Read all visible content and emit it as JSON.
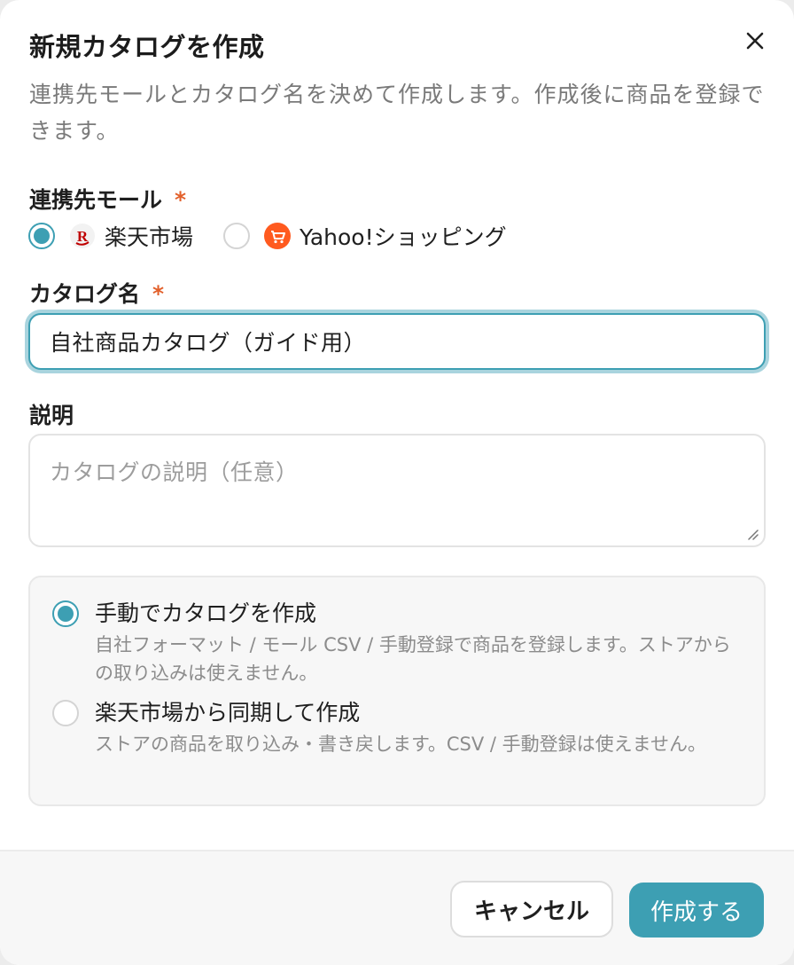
{
  "dialog": {
    "title": "新規カタログを作成",
    "subtitle": "連携先モールとカタログ名を決めて作成します。作成後に商品を登録できます。"
  },
  "mall": {
    "label": "連携先モール",
    "required_mark": "*",
    "options": [
      {
        "label": "楽天市場",
        "icon": "rakuten-logo-icon",
        "selected": true
      },
      {
        "label": "Yahoo!ショッピング",
        "icon": "yahoo-shopping-logo-icon",
        "selected": false
      }
    ]
  },
  "catalog_name": {
    "label": "カタログ名",
    "required_mark": "*",
    "value": "自社商品カタログ（ガイド用）"
  },
  "description": {
    "label": "説明",
    "placeholder": "カタログの説明（任意）",
    "value": ""
  },
  "creation_mode": {
    "options": [
      {
        "title": "手動でカタログを作成",
        "description": "自社フォーマット / モール CSV / 手動登録で商品を登録します。ストアからの取り込みは使えません。",
        "selected": true
      },
      {
        "title": "楽天市場から同期して作成",
        "description": "ストアの商品を取り込み・書き戻します。CSV / 手動登録は使えません。",
        "selected": false
      }
    ]
  },
  "footer": {
    "cancel_label": "キャンセル",
    "create_label": "作成する"
  },
  "colors": {
    "accent": "#3d9fb3",
    "required": "#e2602b",
    "rakuten": "#bf0000",
    "yahoo": "#ff5a1f"
  }
}
